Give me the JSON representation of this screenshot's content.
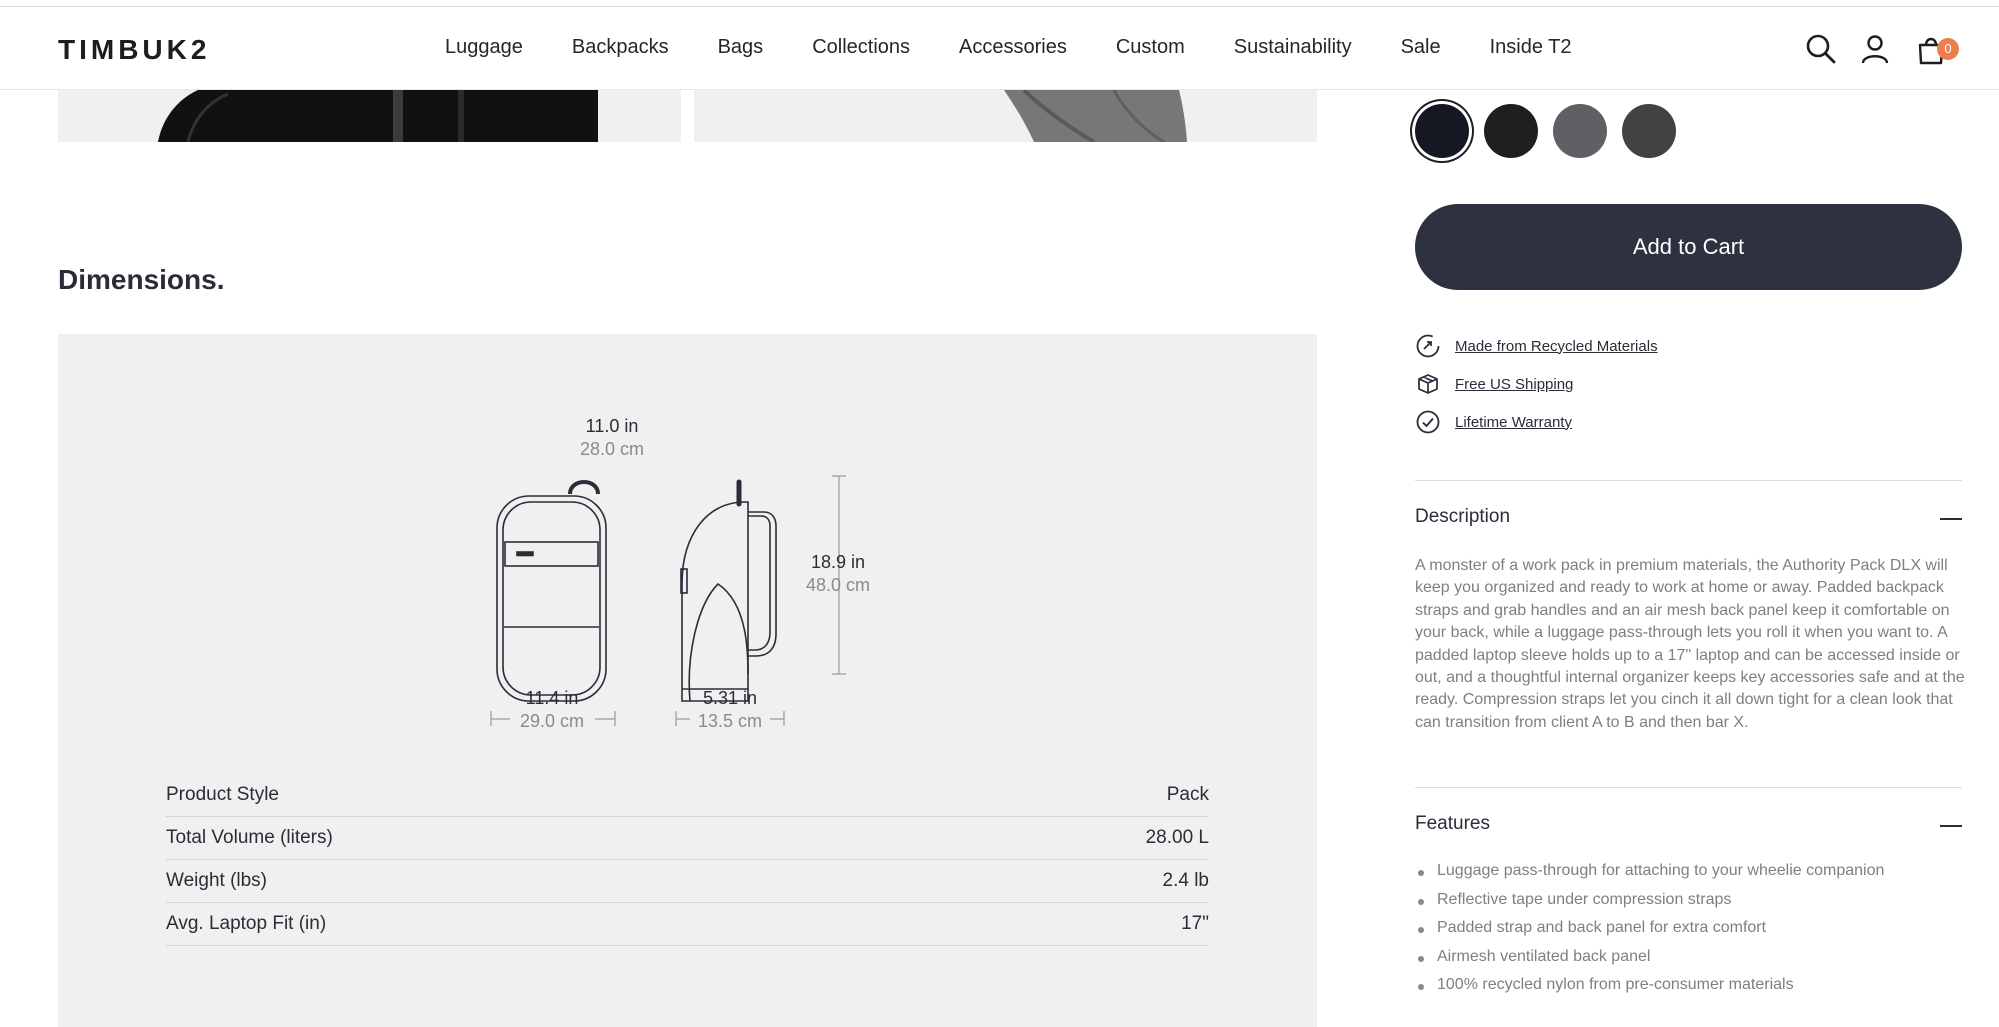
{
  "header": {
    "logo": "TIMBUK2",
    "nav": [
      "Luggage",
      "Backpacks",
      "Bags",
      "Collections",
      "Accessories",
      "Custom",
      "Sustainability",
      "Sale",
      "Inside T2"
    ],
    "cart_count": "0"
  },
  "dimensions": {
    "title": "Dimensions.",
    "top": {
      "in": "11.0 in",
      "cm": "28.0 cm"
    },
    "width": {
      "in": "11.4 in",
      "cm": "29.0 cm"
    },
    "depth": {
      "in": "5.31 in",
      "cm": "13.5 cm"
    },
    "height": {
      "in": "18.9 in",
      "cm": "48.0 cm"
    },
    "specs": [
      {
        "label": "Product Style",
        "value": "Pack"
      },
      {
        "label": "Total Volume (liters)",
        "value": "28.00 L"
      },
      {
        "label": "Weight (lbs)",
        "value": "2.4 lb"
      },
      {
        "label": "Avg. Laptop Fit (in)",
        "value": "17\""
      }
    ]
  },
  "product": {
    "swatch_colors": [
      "#151822",
      "#1e1f20",
      "#5f6063",
      "#414244"
    ],
    "add_to_cart": "Add to Cart",
    "perks": [
      "Made from Recycled Materials",
      "Free US Shipping",
      "Lifetime Warranty"
    ],
    "description_title": "Description",
    "description": "A monster of a work pack in premium materials, the Authority Pack DLX will keep you organized and ready to work at home or away. Padded backpack straps and grab handles and an air mesh back panel keep it comfortable on your back, while a luggage pass-through lets you roll it when you want to. A padded laptop sleeve holds up to a 17\" laptop and can be accessed inside or out, and a thoughtful internal organizer keeps key accessories safe and at the ready. Compression straps let you cinch it all down tight for a clean look that can transition from client A to B and then bar X.",
    "features_title": "Features",
    "features": [
      "Luggage pass-through for attaching to your wheelie companion",
      "Reflective tape under compression straps",
      "Padded strap and back panel for extra comfort",
      "Airmesh ventilated back panel",
      "100% recycled nylon from pre-consumer materials"
    ]
  }
}
